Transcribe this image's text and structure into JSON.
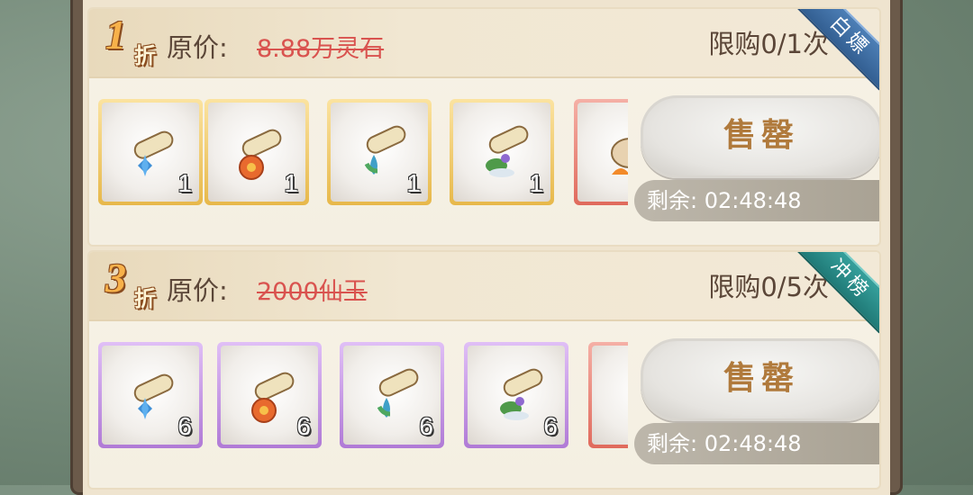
{
  "offers": [
    {
      "discount_num": "1",
      "discount_char": "折",
      "orig_label": "原价:",
      "orig_price": "8.88万灵石",
      "limit": "限购0/1次",
      "ribbon": "白嫖",
      "ribbon_color": "#3f6fa5",
      "items": [
        {
          "icon": "scroll-ice-icon",
          "count": "1",
          "frame": "gold"
        },
        {
          "icon": "scroll-fire-icon",
          "count": "1",
          "frame": "gold"
        },
        {
          "icon": "scroll-water-icon",
          "count": "1",
          "frame": "gold"
        },
        {
          "icon": "scroll-wood-icon",
          "count": "1",
          "frame": "gold"
        },
        {
          "icon": "beast-fire-icon",
          "count": "",
          "frame": "red"
        }
      ],
      "buy_label": "售罄",
      "remain": "剩余: 02:48:48"
    },
    {
      "discount_num": "3",
      "discount_char": "折",
      "orig_label": "原价:",
      "orig_price": "2000仙玉",
      "limit": "限购0/5次",
      "ribbon": "冲榜",
      "ribbon_color": "#2a8c88",
      "items": [
        {
          "icon": "scroll-ice-icon",
          "count": "6",
          "frame": "purple"
        },
        {
          "icon": "scroll-fire-icon",
          "count": "6",
          "frame": "purple"
        },
        {
          "icon": "scroll-water-icon",
          "count": "6",
          "frame": "purple"
        },
        {
          "icon": "scroll-wood-icon",
          "count": "6",
          "frame": "purple"
        },
        {
          "icon": "vase-icon",
          "count": "",
          "frame": "red"
        }
      ],
      "buy_label": "售罄",
      "remain": "剩余: 02:48:48"
    }
  ]
}
